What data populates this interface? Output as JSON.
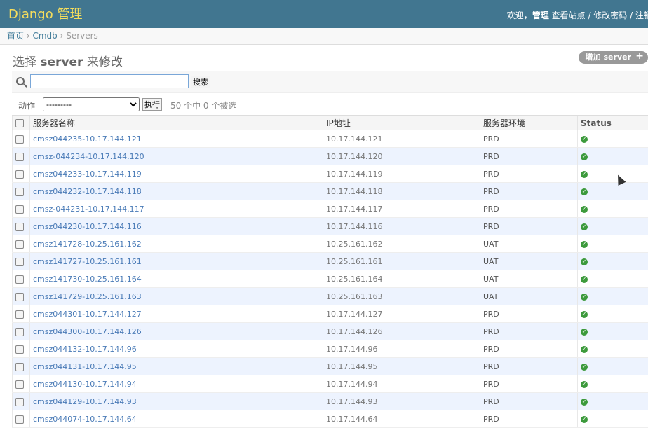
{
  "header": {
    "brand": "Django 管理",
    "welcome": "欢迎，",
    "username": "管理",
    "view_site": "查看站点",
    "sep": " / ",
    "change_password": "修改密码",
    "logout": "注销"
  },
  "breadcrumbs": {
    "home": "首页",
    "app": "Cmdb",
    "model": "Servers",
    "sep": " › "
  },
  "page": {
    "title_prefix": "选择 ",
    "title_model": "server",
    "title_suffix": " 来修改",
    "add_label": "增加 server",
    "add_icon": "plus-icon"
  },
  "search": {
    "value": "",
    "button_label": "搜索"
  },
  "actions": {
    "label": "动作",
    "selected": "---------",
    "go_label": "执行",
    "counter": "50 个中 0 个被选"
  },
  "table": {
    "headers": [
      "服务器名称",
      "IP地址",
      "服务器环境",
      "Status"
    ],
    "rows": [
      {
        "name": "cmsz044235-10.17.144.121",
        "ip": "10.17.144.121",
        "env": "PRD"
      },
      {
        "name": "cmsz-044234-10.17.144.120",
        "ip": "10.17.144.120",
        "env": "PRD"
      },
      {
        "name": "cmsz044233-10.17.144.119",
        "ip": "10.17.144.119",
        "env": "PRD"
      },
      {
        "name": "cmsz044232-10.17.144.118",
        "ip": "10.17.144.118",
        "env": "PRD"
      },
      {
        "name": "cmsz-044231-10.17.144.117",
        "ip": "10.17.144.117",
        "env": "PRD"
      },
      {
        "name": "cmsz044230-10.17.144.116",
        "ip": "10.17.144.116",
        "env": "PRD"
      },
      {
        "name": "cmsz141728-10.25.161.162",
        "ip": "10.25.161.162",
        "env": "UAT"
      },
      {
        "name": "cmsz141727-10.25.161.161",
        "ip": "10.25.161.161",
        "env": "UAT"
      },
      {
        "name": "cmsz141730-10.25.161.164",
        "ip": "10.25.161.164",
        "env": "UAT"
      },
      {
        "name": "cmsz141729-10.25.161.163",
        "ip": "10.25.161.163",
        "env": "UAT"
      },
      {
        "name": "cmsz044301-10.17.144.127",
        "ip": "10.17.144.127",
        "env": "PRD"
      },
      {
        "name": "cmsz044300-10.17.144.126",
        "ip": "10.17.144.126",
        "env": "PRD"
      },
      {
        "name": "cmsz044132-10.17.144.96",
        "ip": "10.17.144.96",
        "env": "PRD"
      },
      {
        "name": "cmsz044131-10.17.144.95",
        "ip": "10.17.144.95",
        "env": "PRD"
      },
      {
        "name": "cmsz044130-10.17.144.94",
        "ip": "10.17.144.94",
        "env": "PRD"
      },
      {
        "name": "cmsz044129-10.17.144.93",
        "ip": "10.17.144.93",
        "env": "PRD"
      },
      {
        "name": "cmsz044074-10.17.144.64",
        "ip": "10.17.144.64",
        "env": "PRD"
      }
    ]
  },
  "colors": {
    "header_bg": "#417690",
    "brand": "#f5dd5d",
    "link": "#447e9b",
    "row_alt": "#edf3fe",
    "status_ok": "#3c9a3c"
  }
}
